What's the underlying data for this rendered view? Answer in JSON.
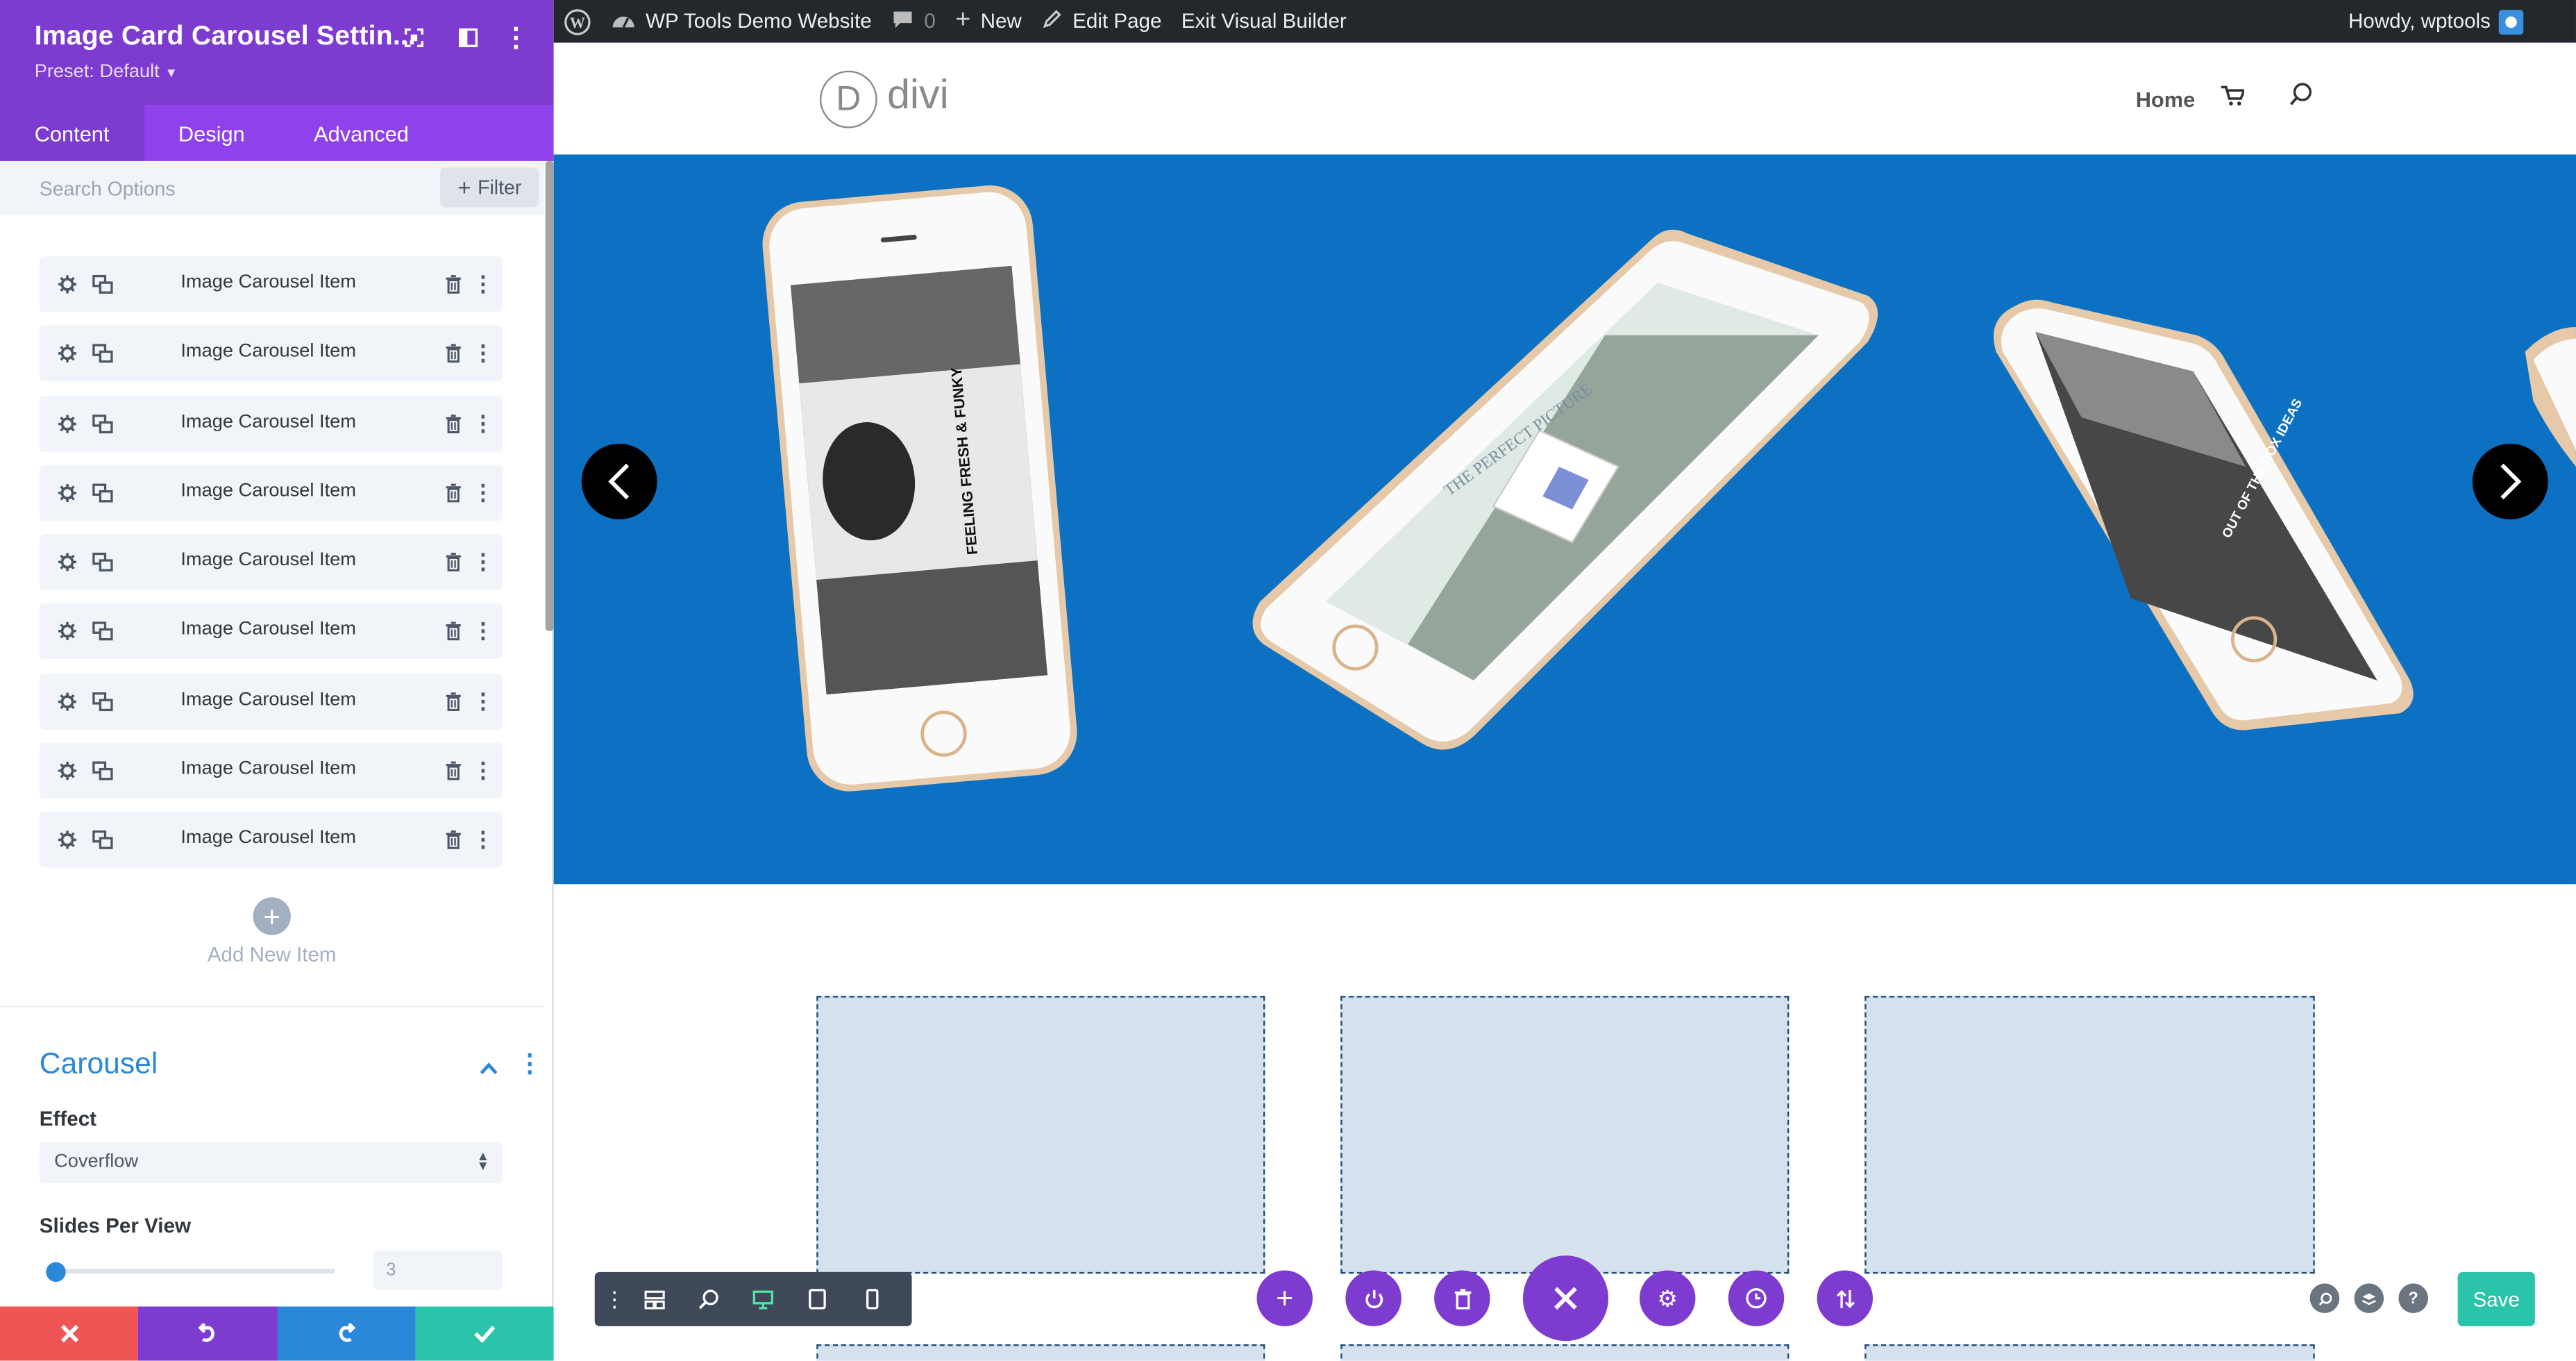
{
  "admin_bar": {
    "site_name": "WP Tools Demo Website",
    "comments_count": "0",
    "new_label": "New",
    "edit_label": "Edit Page",
    "exit_label": "Exit Visual Builder",
    "howdy": "Howdy, wptools"
  },
  "panel": {
    "title": "Image Card Carousel Settin...",
    "preset": "Preset: Default",
    "tabs": [
      "Content",
      "Design",
      "Advanced"
    ],
    "search_placeholder": "Search Options",
    "filter_label": "Filter",
    "items": [
      "Image Carousel Item",
      "Image Carousel Item",
      "Image Carousel Item",
      "Image Carousel Item",
      "Image Carousel Item",
      "Image Carousel Item",
      "Image Carousel Item",
      "Image Carousel Item",
      "Image Carousel Item"
    ],
    "add_item_label": "Add New Item",
    "section_title": "Carousel",
    "effect_label": "Effect",
    "effect_value": "Coverflow",
    "slides_label": "Slides Per View",
    "slides_value": "3",
    "slides_fraction": 0.0
  },
  "site": {
    "logo_letter": "D",
    "logo_text": "divi",
    "nav_home": "Home",
    "phone_texts": {
      "left": "FEELING FRESH & FUNKY",
      "middle": "THE PERFECT PICTURE",
      "right": "OUT OF THE BOX IDEAS"
    }
  },
  "bottom_bar": {
    "save_label": "Save"
  },
  "colors": {
    "panel_purple": "#7e3bd0",
    "hero_blue": "#0c71c3",
    "save_green": "#29c4a9",
    "cancel_red": "#ef5555",
    "redo_blue": "#2b87da"
  }
}
